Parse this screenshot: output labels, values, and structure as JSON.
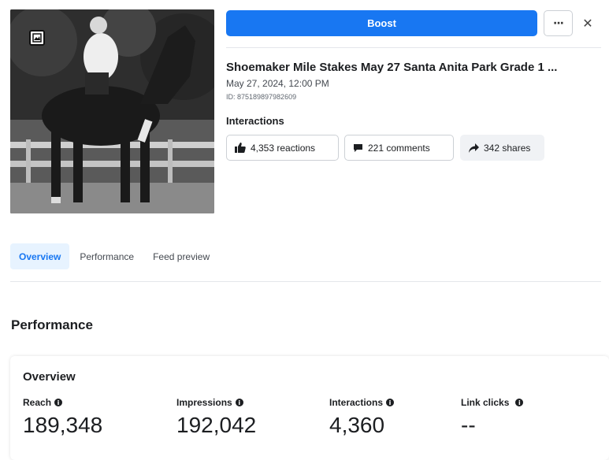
{
  "actions": {
    "boost_label": "Boost",
    "more_label": "···",
    "close_label": "✕"
  },
  "post": {
    "title": "Shoemaker Mile Stakes May 27 Santa Anita Park Grade 1 ...",
    "date": "May 27, 2024, 12:00 PM",
    "id": "ID: 875189897982609",
    "thumbnail_icon": "photo-badge-icon"
  },
  "interactions": {
    "label": "Interactions",
    "reactions": "4,353 reactions",
    "comments": "221 comments",
    "shares": "342 shares"
  },
  "tabs": [
    {
      "label": "Overview",
      "active": true
    },
    {
      "label": "Performance",
      "active": false
    },
    {
      "label": "Feed preview",
      "active": false
    }
  ],
  "performance": {
    "heading": "Performance",
    "overview": {
      "heading": "Overview",
      "metrics": [
        {
          "label": "Reach",
          "value": "189,348",
          "info": true
        },
        {
          "label": "Impressions",
          "value": "192,042",
          "info": true
        },
        {
          "label": "Interactions",
          "value": "4,360",
          "info": true
        },
        {
          "label": "Link clicks",
          "value": "--",
          "info": true
        }
      ]
    }
  },
  "colors": {
    "accent": "#1877f2",
    "active_tab_bg": "#e7f3ff",
    "text": "#1c1e21"
  }
}
